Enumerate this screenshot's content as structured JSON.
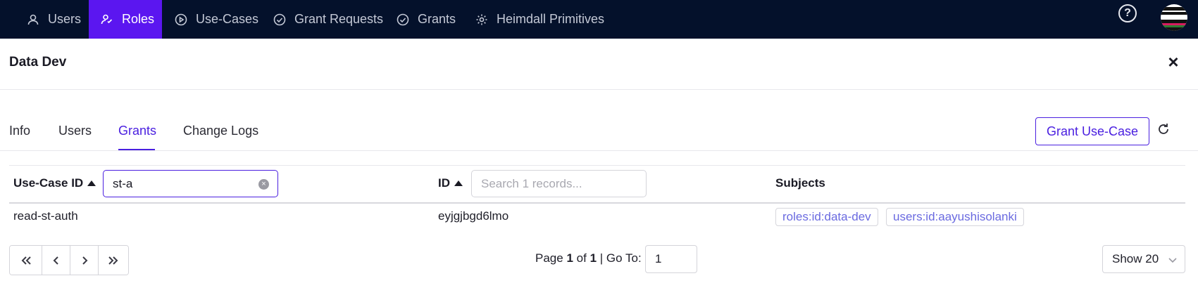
{
  "nav": {
    "items": [
      {
        "label": "Users",
        "icon": "user-icon"
      },
      {
        "label": "Roles",
        "icon": "roles-icon"
      },
      {
        "label": "Use-Cases",
        "icon": "play-circle-icon"
      },
      {
        "label": "Grant Requests",
        "icon": "check-circle-icon"
      },
      {
        "label": "Grants",
        "icon": "check-circle-icon"
      },
      {
        "label": "Heimdall Primitives",
        "icon": "gear-icon"
      }
    ],
    "active": "Roles",
    "help_label": "?"
  },
  "panel": {
    "title": "Data Dev",
    "close_label": "×"
  },
  "tabs": {
    "items": [
      "Info",
      "Users",
      "Grants",
      "Change Logs"
    ],
    "active": "Grants",
    "grant_button": "Grant Use-Case"
  },
  "table": {
    "columns": [
      {
        "label": "Use-Case ID",
        "filter_value": "st-a",
        "filter_placeholder": ""
      },
      {
        "label": "ID",
        "filter_value": "",
        "filter_placeholder": "Search 1 records..."
      },
      {
        "label": "Subjects"
      }
    ],
    "rows": [
      {
        "use_case_id": "read-st-auth",
        "id": "eyjgjbgd6lmo",
        "subjects": [
          "roles:id:data-dev",
          "users:id:aayushisolanki"
        ]
      }
    ]
  },
  "pagination": {
    "page_label": "Page",
    "current_page": "1",
    "of_label": "of",
    "total_pages": "1",
    "goto_label": "| Go To:",
    "goto_value": "1",
    "page_size_label": "Show 20"
  },
  "colors": {
    "nav_bg": "#04112b",
    "nav_active": "#5b16f0",
    "accent": "#4a1fe0",
    "chip_text": "#6a6ae0"
  }
}
